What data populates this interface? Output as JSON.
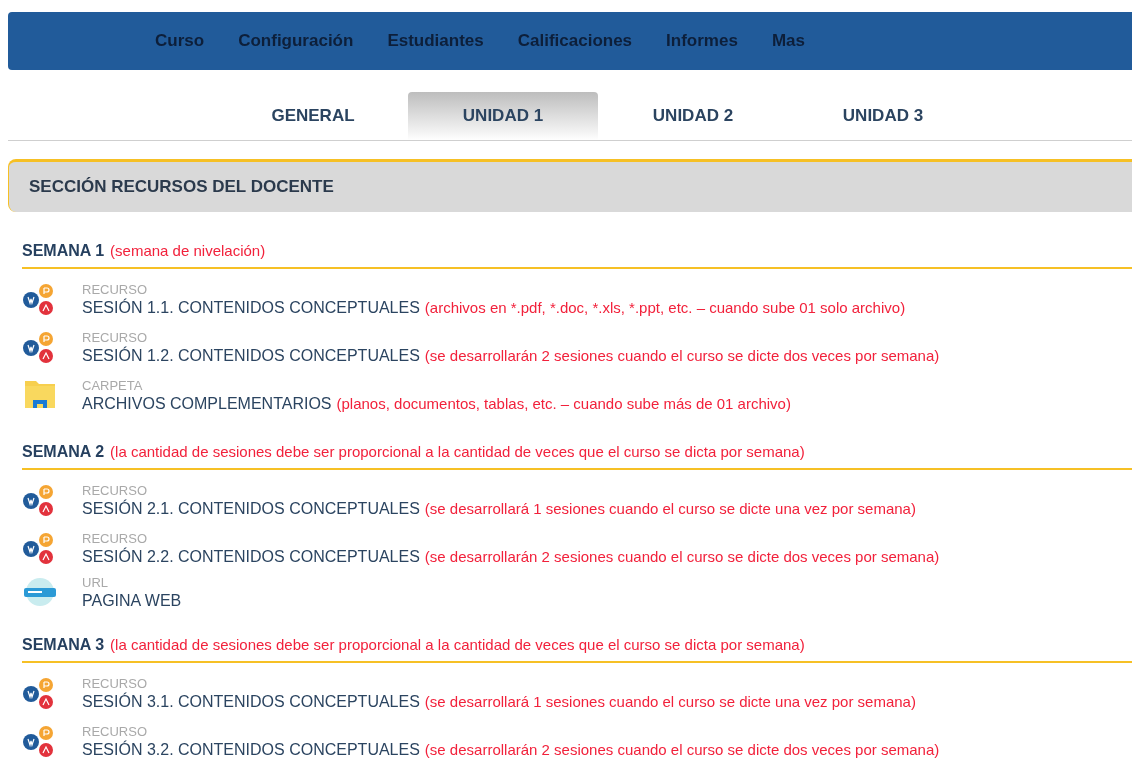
{
  "nav": [
    "Curso",
    "Configuración",
    "Estudiantes",
    "Calificaciones",
    "Informes",
    "Mas"
  ],
  "tabs": [
    {
      "label": "GENERAL",
      "selected": false
    },
    {
      "label": "UNIDAD 1",
      "selected": true
    },
    {
      "label": "UNIDAD 2",
      "selected": false
    },
    {
      "label": "UNIDAD 3",
      "selected": false
    }
  ],
  "section": {
    "title": "SECCIÓN RECURSOS DEL DOCENTE"
  },
  "weeks": [
    {
      "title": "SEMANA 1",
      "note": "(semana de nivelación)",
      "items": [
        {
          "kind": "resource",
          "type": "RECURSO",
          "title": "SESIÓN 1.1. CONTENIDOS CONCEPTUALES",
          "note": "(archivos en *.pdf, *.doc, *.xls, *.ppt, etc. – cuando sube 01 solo archivo)"
        },
        {
          "kind": "resource",
          "type": "RECURSO",
          "title": "SESIÓN 1.2. CONTENIDOS CONCEPTUALES",
          "note": "(se desarrollarán 2 sesiones cuando el curso se dicte dos veces por semana)"
        },
        {
          "kind": "folder",
          "type": "CARPETA",
          "title": "ARCHIVOS COMPLEMENTARIOS",
          "note": "(planos, documentos, tablas, etc. – cuando sube más de 01 archivo)"
        }
      ]
    },
    {
      "title": "SEMANA 2",
      "note": "(la cantidad de sesiones debe ser proporcional a la cantidad de veces que el curso se dicta por semana)",
      "items": [
        {
          "kind": "resource",
          "type": "RECURSO",
          "title": "SESIÓN 2.1. CONTENIDOS CONCEPTUALES",
          "note": "(se desarrollará 1 sesiones cuando el curso se dicte una vez por semana)"
        },
        {
          "kind": "resource",
          "type": "RECURSO",
          "title": "SESIÓN 2.2. CONTENIDOS CONCEPTUALES",
          "note": "(se desarrollarán 2 sesiones cuando el curso se dicte dos veces por semana)"
        },
        {
          "kind": "url",
          "type": "URL",
          "title": "PAGINA WEB"
        }
      ]
    },
    {
      "title": "SEMANA 3",
      "note": "(la cantidad de sesiones debe ser proporcional a la cantidad de veces que el curso se dicta por semana)",
      "items": [
        {
          "kind": "resource",
          "type": "RECURSO",
          "title": "SESIÓN 3.1. CONTENIDOS CONCEPTUALES",
          "note": "(se desarrollará 1 sesiones cuando el curso se dicte una vez por semana)"
        },
        {
          "kind": "resource",
          "type": "RECURSO",
          "title": "SESIÓN 3.2. CONTENIDOS CONCEPTUALES",
          "note": "(se desarrollarán 2 sesiones cuando el curso se dicte dos veces por semana)"
        }
      ]
    }
  ]
}
